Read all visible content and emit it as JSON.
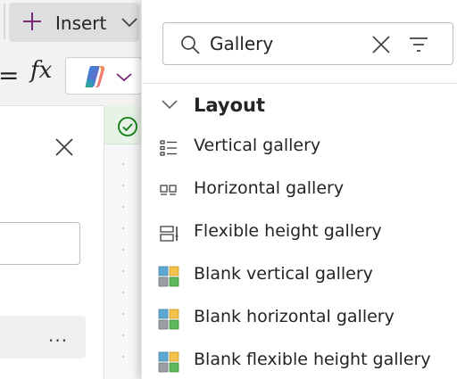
{
  "toolbar": {
    "insert_label": "Insert",
    "formula_symbol": "=",
    "fx_label": "fx"
  },
  "popup": {
    "search": {
      "value": "Gallery",
      "placeholder": "Search"
    },
    "section": {
      "title": "Layout"
    },
    "items": [
      {
        "label": "Vertical gallery",
        "icon": "vertical-gallery-icon"
      },
      {
        "label": "Horizontal gallery",
        "icon": "horizontal-gallery-icon"
      },
      {
        "label": "Flexible height gallery",
        "icon": "flexible-height-gallery-icon"
      },
      {
        "label": "Blank vertical gallery",
        "icon": "blank-gallery-icon"
      },
      {
        "label": "Blank horizontal gallery",
        "icon": "blank-gallery-icon"
      },
      {
        "label": "Blank flexible height gallery",
        "icon": "blank-gallery-icon"
      }
    ]
  },
  "left_panel": {
    "more_label": "..."
  },
  "colors": {
    "accent_purple": "#742774",
    "success_green": "#107c10",
    "tile_blue": "#5fa8d3",
    "tile_yellow": "#f2c14e",
    "tile_green": "#5cb85c",
    "tile_gray": "#9aa0a6"
  }
}
